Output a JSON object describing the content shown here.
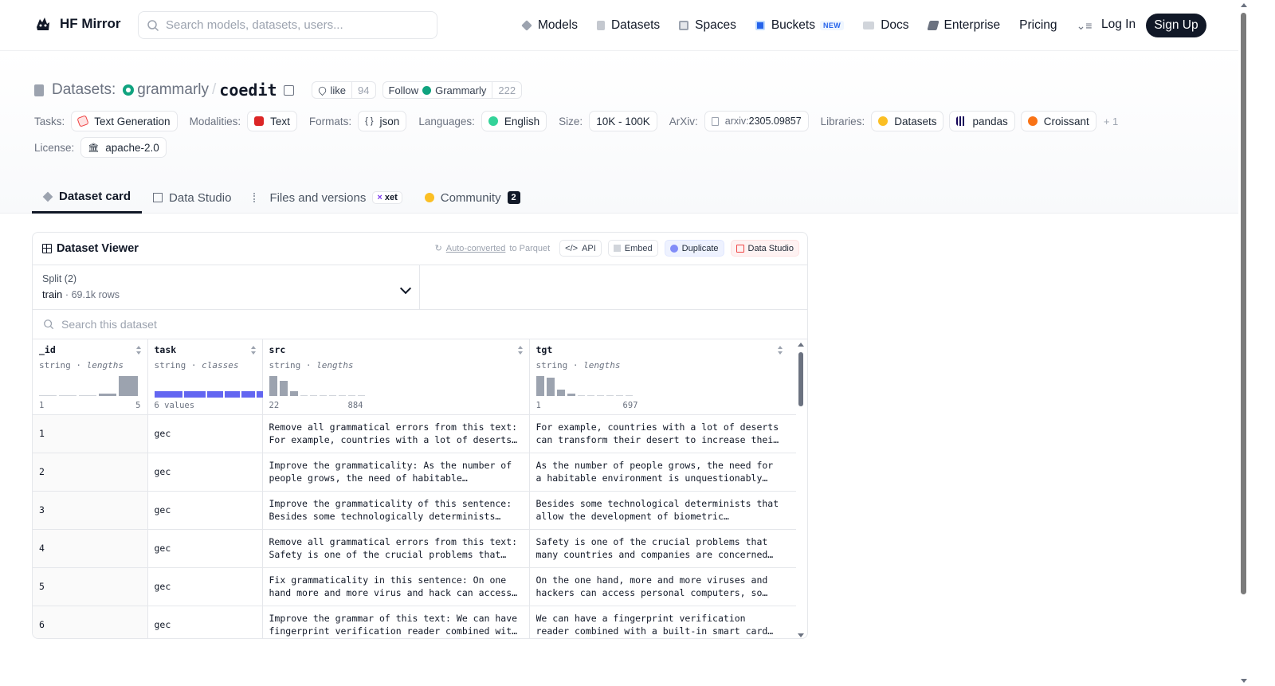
{
  "header": {
    "brand": "HF Mirror",
    "search_placeholder": "Search models, datasets, users...",
    "nav": [
      {
        "label": "Models",
        "icon": "models-icon"
      },
      {
        "label": "Datasets",
        "icon": "datasets-icon"
      },
      {
        "label": "Spaces",
        "icon": "spaces-icon"
      },
      {
        "label": "Buckets",
        "icon": "buckets-icon",
        "badge": "NEW"
      },
      {
        "label": "Docs",
        "icon": "docs-icon"
      },
      {
        "label": "Enterprise",
        "icon": "enterprise-icon"
      },
      {
        "label": "Pricing"
      }
    ],
    "login": "Log In",
    "signup": "Sign Up"
  },
  "repo": {
    "prefix": "Datasets:",
    "org": "grammarly",
    "name": "coedit",
    "like_label": "like",
    "like_count": "94",
    "follow_label": "Follow",
    "follow_org": "Grammarly",
    "follow_count": "222"
  },
  "meta": {
    "tasks_label": "Tasks:",
    "task": "Text Generation",
    "modalities_label": "Modalities:",
    "modality": "Text",
    "formats_label": "Formats:",
    "format": "json",
    "languages_label": "Languages:",
    "language": "English",
    "size_label": "Size:",
    "size": "10K - 100K",
    "arxiv_label": "ArXiv:",
    "arxiv_prefix": "arxiv:",
    "arxiv_id": "2305.09857",
    "libraries_label": "Libraries:",
    "libraries": [
      "Datasets",
      "pandas",
      "Croissant"
    ],
    "libraries_more": "+ 1",
    "license_label": "License:",
    "license": "apache-2.0"
  },
  "tabs": {
    "dataset_card": "Dataset card",
    "data_studio": "Data Studio",
    "files": "Files and versions",
    "xet": "xet",
    "community": "Community",
    "community_count": "2"
  },
  "viewer": {
    "title": "Dataset Viewer",
    "auto_converted": "Auto-converted",
    "to_parquet": " to Parquet",
    "api": "API",
    "embed": "Embed",
    "duplicate": "Duplicate",
    "data_studio": "Data Studio",
    "split_label": "Split (2)",
    "split_name": "train",
    "split_rows": "69.1k rows",
    "search_placeholder": "Search this dataset",
    "columns": [
      {
        "name": "_id",
        "type": "string",
        "stat": "lengths",
        "min": "1",
        "max": "5"
      },
      {
        "name": "task",
        "type": "string",
        "stat": "classes",
        "values_label": "6 values"
      },
      {
        "name": "src",
        "type": "string",
        "stat": "lengths",
        "min": "22",
        "max": "884"
      },
      {
        "name": "tgt",
        "type": "string",
        "stat": "lengths",
        "min": "1",
        "max": "697"
      }
    ],
    "rows": [
      {
        "id": "1",
        "task": "gec",
        "src": "Remove all grammatical errors from this text: For example, countries with a lot of deserts can transform their desert to increase their territories for living.",
        "tgt": "For example, countries with a lot of deserts can transform their desert to increase their territories for living."
      },
      {
        "id": "2",
        "task": "gec",
        "src": "Improve the grammaticality: As the number of people grows, the need of habitable environment is unquestionably essential.",
        "tgt": "As the number of people grows, the need for a habitable environment is unquestionably essential."
      },
      {
        "id": "3",
        "task": "gec",
        "src": "Improve the grammaticality of this sentence: Besides some technologically determinists that allow the development of biometric identification.",
        "tgt": "Besides some technological determinists that allow the development of biometric identification."
      },
      {
        "id": "4",
        "task": "gec",
        "src": "Remove all grammatical errors from this text: Safety is one of the crucial problems that many countries and companies concern.",
        "tgt": "Safety is one of the crucial problems that many countries and companies are concerned about."
      },
      {
        "id": "5",
        "task": "gec",
        "src": "Fix grammaticality in this sentence: On one hand more and more virus and hack can access personal computers.",
        "tgt": "On the one hand, more and more viruses and hackers can access personal computers, so data is no longer secure."
      },
      {
        "id": "6",
        "task": "gec",
        "src": "Improve the grammar of this text: We can have fingerprint verification reader combined with a built-in smart card reader.",
        "tgt": "We can have a fingerprint verification reader combined with a built-in smart card reader, which is safer."
      }
    ]
  }
}
